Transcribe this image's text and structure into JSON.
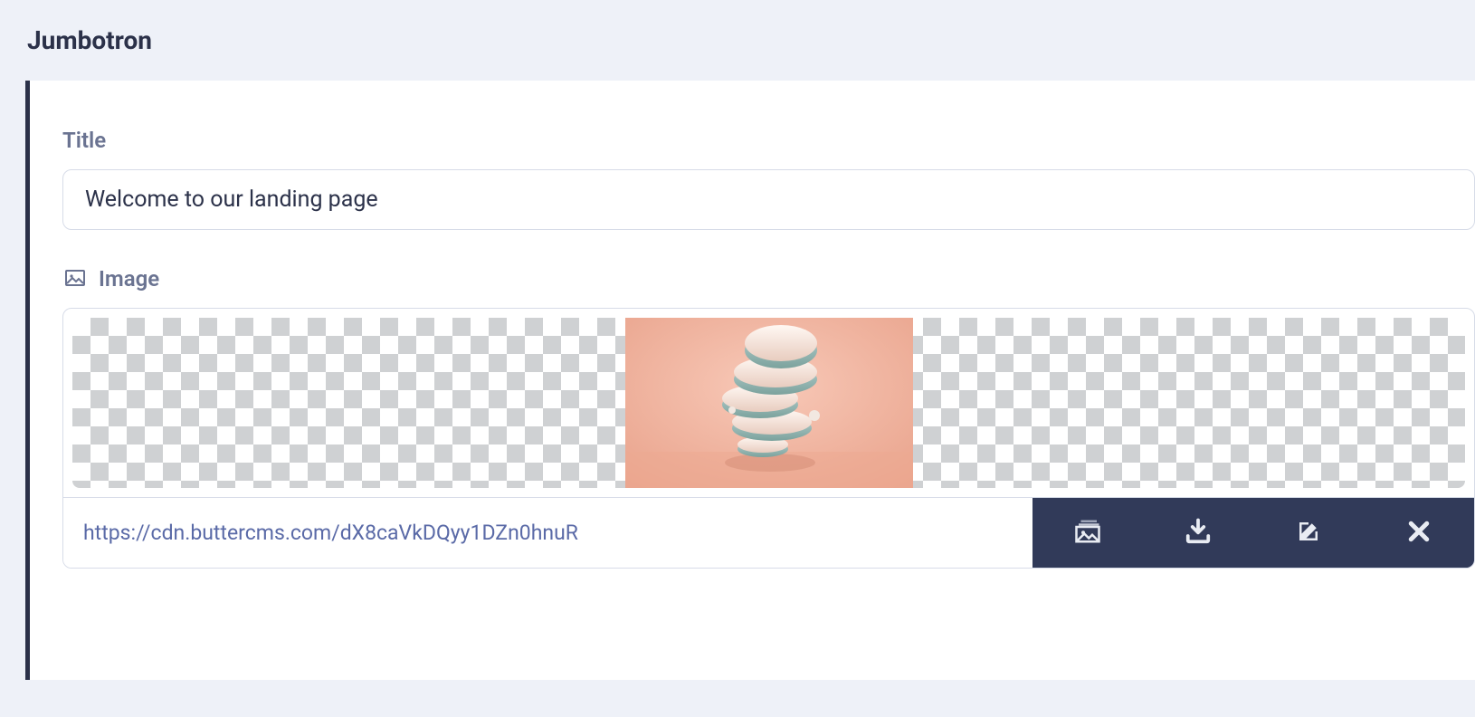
{
  "section": {
    "title": "Jumbotron"
  },
  "fields": {
    "title": {
      "label": "Title",
      "value": "Welcome to our landing page"
    },
    "image": {
      "label": "Image",
      "url": "https://cdn.buttercms.com/dX8caVkDQyy1DZn0hnuR",
      "actions": {
        "library": "media-library-icon",
        "download": "download-icon",
        "edit": "edit-icon",
        "remove": "close-icon"
      }
    }
  }
}
